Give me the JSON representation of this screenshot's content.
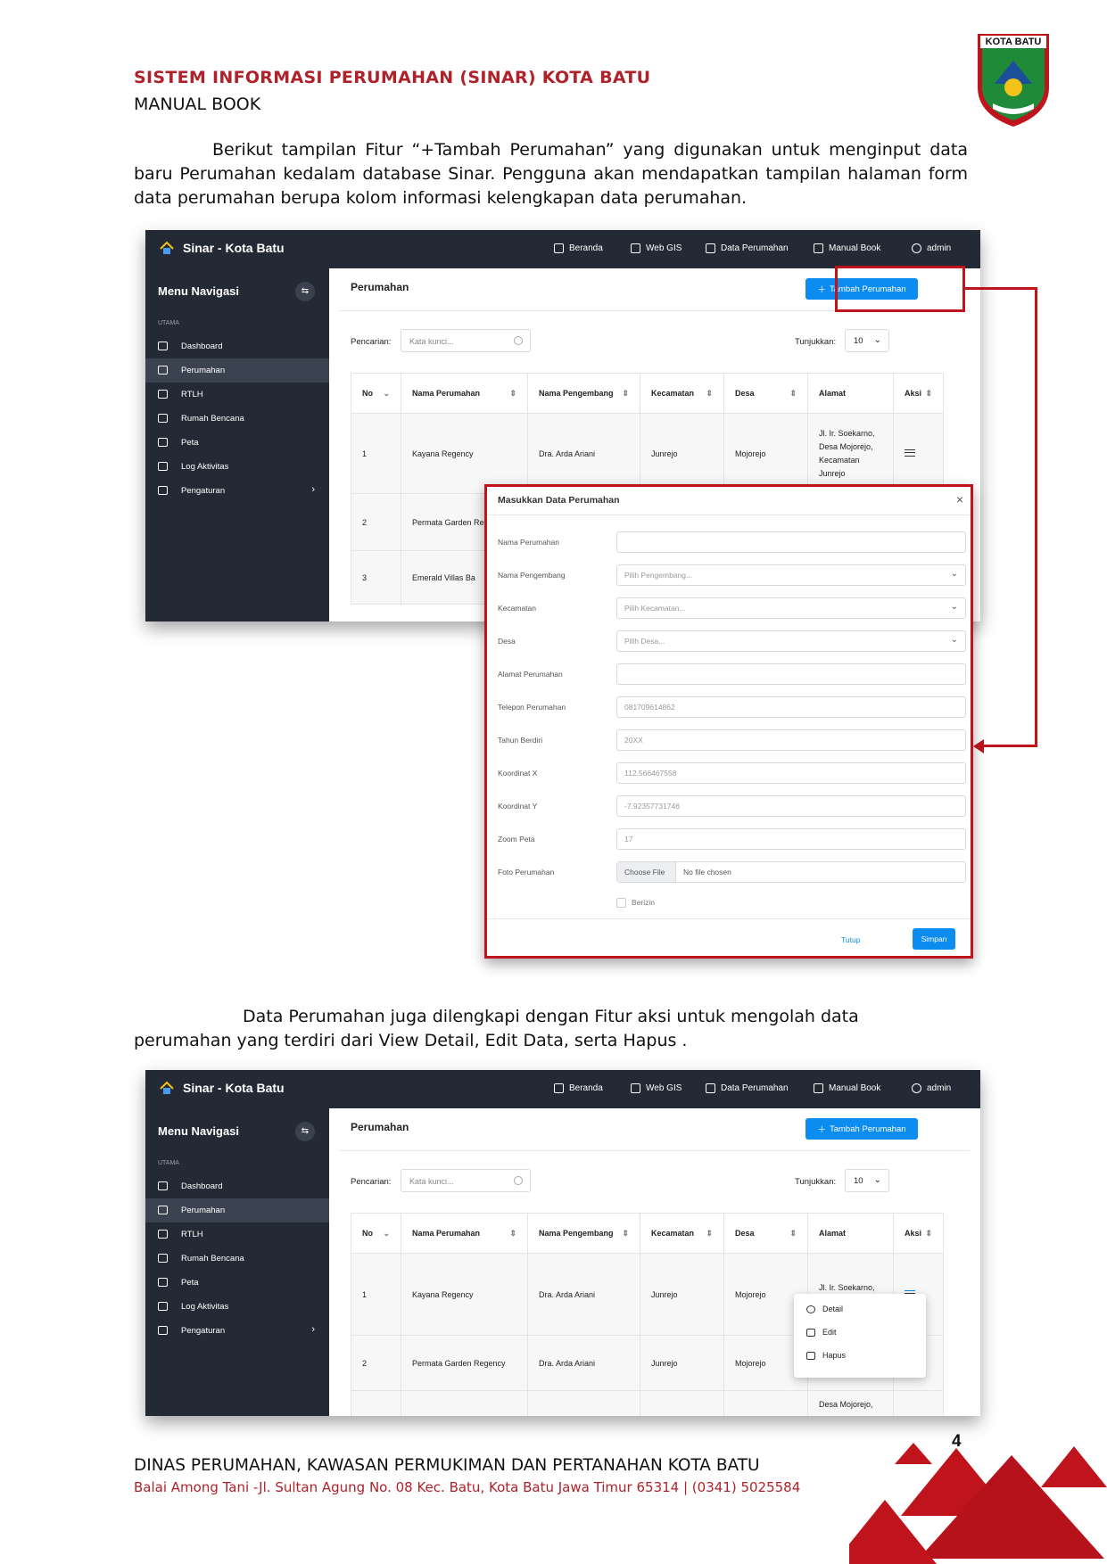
{
  "document": {
    "title": "SISTEM INFORMASI PERUMAHAN (SINAR) KOTA BATU",
    "subtitle": "MANUAL BOOK",
    "logo_text": "KOTA BATU",
    "paragraph_1": "Berikut tampilan Fitur “+Tambah Perumahan” yang digunakan untuk menginput data baru Perumahan kedalam database Sinar. Pengguna akan mendapatkan tampilan halaman form data perumahan berupa kolom informasi kelengkapan data perumahan.",
    "paragraph_2": "Data Perumahan juga dilengkapi dengan Fitur aksi untuk mengolah data perumahan yang terdiri dari View Detail, Edit Data, serta Hapus .",
    "page_number": "4",
    "footer_line_1": "DINAS PERUMAHAN, KAWASAN PERMUKIMAN DAN PERTANAHAN KOTA BATU",
    "footer_line_2": "Balai Among Tani -Jl. Sultan Agung No. 08 Kec. Batu, Kota Batu Jawa Timur 65314 | (0341) 5025584",
    "accent_color": "#b0222a"
  },
  "app": {
    "brand": "Sinar - Kota Batu",
    "nav": {
      "beranda": "Beranda",
      "webgis": "Web GIS",
      "data_perumahan": "Data Perumahan",
      "manual_book": "Manual Book",
      "user": "admin"
    },
    "sidebar": {
      "title": "Menu Navigasi",
      "section": "UTAMA",
      "items": [
        "Dashboard",
        "Perumahan",
        "RTLH",
        "Rumah Bencana",
        "Peta",
        "Log Aktivitas",
        "Pengaturan"
      ]
    },
    "page_title": "Perumahan",
    "add_button": "Tambah Perumahan",
    "search_label": "Pencarian:",
    "search_placeholder": "Kata kunci...",
    "show_label": "Tunjukkan:",
    "show_value": "10",
    "table_headers": {
      "no": "No",
      "nama": "Nama Perumahan",
      "pengembang": "Nama Pengembang",
      "kecamatan": "Kecamatan",
      "desa": "Desa",
      "alamat": "Alamat",
      "aksi": "Aksi"
    },
    "rows": [
      {
        "no": "1",
        "nama": "Kayana Regency",
        "pengembang": "Dra. Arda Ariani",
        "kecamatan": "Junrejo",
        "desa": "Mojorejo",
        "alamat_1": "Jl. Ir. Soekarno, Desa Mojorejo, Kecamatan Junrejo",
        "alamat_2": "Jl. Ir. Soekarno, Desa Mojorejo,"
      },
      {
        "no": "2",
        "nama": "Permata Garden Regency",
        "pengembang": "Dra. Arda Ariani",
        "kecamatan": "Junrejo",
        "desa": "Mojorejo",
        "alamat_next": "Desa Mojorejo,"
      },
      {
        "no": "3",
        "nama": "Emerald Villas Ba"
      }
    ]
  },
  "modal": {
    "title": "Masukkan Data Perumahan",
    "fields": [
      {
        "label": "Nama Perumahan",
        "value": ""
      },
      {
        "label": "Nama Pengembang",
        "value": "Pilih Pengembang..."
      },
      {
        "label": "Kecamatan",
        "value": "Pilih Kecamatan..."
      },
      {
        "label": "Desa",
        "value": "Pilih Desa..."
      },
      {
        "label": "Alamat Perumahan",
        "value": ""
      },
      {
        "label": "Telepon Perumahan",
        "value": "081709614862"
      },
      {
        "label": "Tahun Berdiri",
        "value": "20XX"
      },
      {
        "label": "Koordinat X",
        "value": "112.566467558"
      },
      {
        "label": "Koordinat Y",
        "value": "-7.92357731746"
      },
      {
        "label": "Zoom Peta",
        "value": "17"
      },
      {
        "label": "Foto Perumahan",
        "file_button": "Choose File",
        "file_text": "No file chosen"
      }
    ],
    "checkbox_label": "Berizin",
    "cancel": "Tutup",
    "save": "Simpan"
  },
  "action_menu": {
    "detail": "Detail",
    "edit": "Edit",
    "hapus": "Hapus"
  }
}
